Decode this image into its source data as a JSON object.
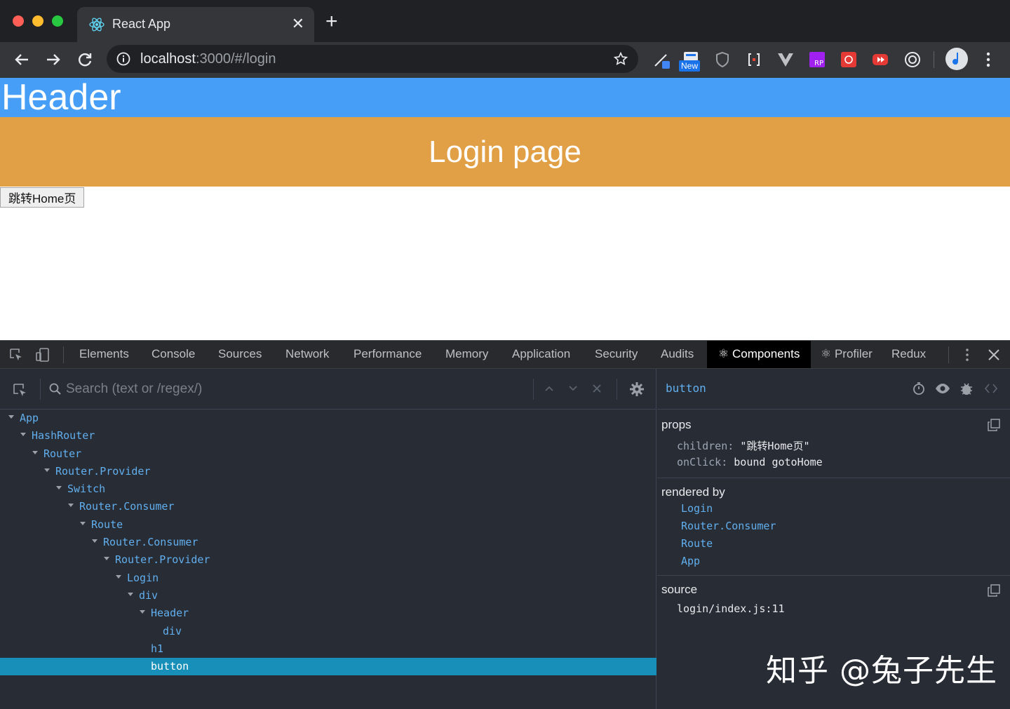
{
  "browser": {
    "tab_title": "React App",
    "new_tab": "+",
    "close": "✕",
    "url_host": "localhost",
    "url_path": ":3000/#/login",
    "ext_badge": "New"
  },
  "page": {
    "header": "Header",
    "login_title": "Login page",
    "goto_button": "跳转Home页",
    "colors": {
      "header": "#479ef7",
      "login": "#e2a046"
    }
  },
  "devtools": {
    "tabs": [
      "Elements",
      "Console",
      "Sources",
      "Network",
      "Performance",
      "Memory",
      "Application",
      "Security",
      "Audits"
    ],
    "active_tab": "⚛ Components",
    "profiler": "⚛ Profiler",
    "redux": "Redux",
    "search_placeholder": "Search (text or /regex/)",
    "tree": [
      {
        "label": "App",
        "depth": 0,
        "caret": true
      },
      {
        "label": "HashRouter",
        "depth": 1,
        "caret": true
      },
      {
        "label": "Router",
        "depth": 2,
        "caret": true
      },
      {
        "label": "Router.Provider",
        "depth": 3,
        "caret": true
      },
      {
        "label": "Switch",
        "depth": 4,
        "caret": true
      },
      {
        "label": "Router.Consumer",
        "depth": 5,
        "caret": true
      },
      {
        "label": "Route",
        "depth": 6,
        "caret": true
      },
      {
        "label": "Router.Consumer",
        "depth": 7,
        "caret": true
      },
      {
        "label": "Router.Provider",
        "depth": 8,
        "caret": true
      },
      {
        "label": "Login",
        "depth": 9,
        "caret": true
      },
      {
        "label": "div",
        "depth": 10,
        "caret": true
      },
      {
        "label": "Header",
        "depth": 11,
        "caret": true
      },
      {
        "label": "div",
        "depth": 12,
        "caret": false
      },
      {
        "label": "h1",
        "depth": 11,
        "caret": false
      },
      {
        "label": "button",
        "depth": 11,
        "caret": false,
        "selected": true
      }
    ],
    "inspector": {
      "selected": "button",
      "props_label": "props",
      "props": [
        {
          "key": "children",
          "value": "\"跳转Home页\""
        },
        {
          "key": "onClick",
          "value": "bound gotoHome"
        }
      ],
      "rendered_by_label": "rendered by",
      "rendered_by": [
        "Login",
        "Router.Consumer",
        "Route",
        "App"
      ],
      "source_label": "source",
      "source": "login/index.js:11"
    }
  },
  "watermark": "知乎 @兔子先生"
}
